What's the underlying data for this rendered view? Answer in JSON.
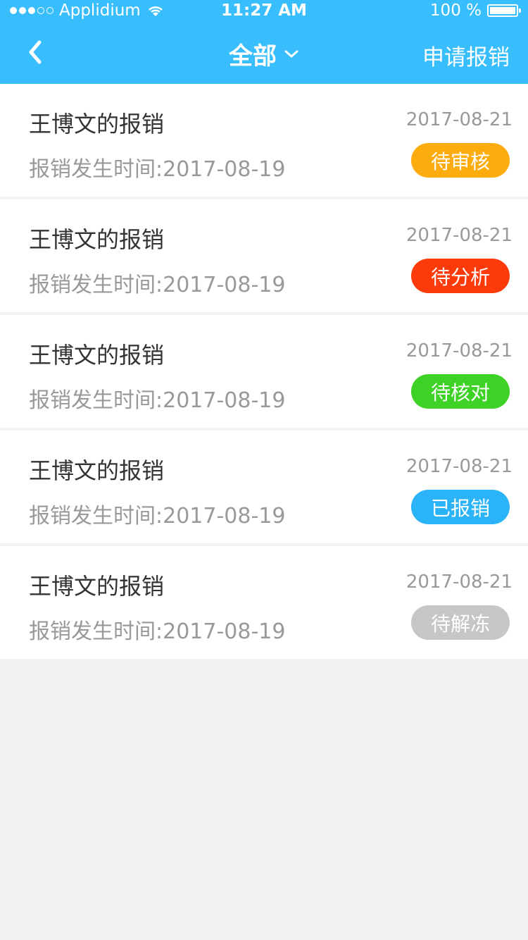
{
  "status_bar": {
    "carrier": "Applidium",
    "time": "11:27 AM",
    "battery_label": "100 %"
  },
  "nav": {
    "title": "全部",
    "apply_label": "申请报销"
  },
  "items": [
    {
      "title": "王博文的报销",
      "date": "2017-08-21",
      "sub_label": "报销发生时间:",
      "sub_date": "2017-08-19",
      "status": "待审核",
      "status_color": "#fdac0e"
    },
    {
      "title": "王博文的报销",
      "date": "2017-08-21",
      "sub_label": "报销发生时间:",
      "sub_date": "2017-08-19",
      "status": "待分析",
      "status_color": "#fd3a0a"
    },
    {
      "title": "王博文的报销",
      "date": "2017-08-21",
      "sub_label": "报销发生时间:",
      "sub_date": "2017-08-19",
      "status": "待核对",
      "status_color": "#3ed126"
    },
    {
      "title": "王博文的报销",
      "date": "2017-08-21",
      "sub_label": "报销发生时间:",
      "sub_date": "2017-08-19",
      "status": "已报销",
      "status_color": "#2ab4f7"
    },
    {
      "title": "王博文的报销",
      "date": "2017-08-21",
      "sub_label": "报销发生时间:",
      "sub_date": "2017-08-19",
      "status": "待解冻",
      "status_color": "#c6c6c6"
    }
  ],
  "colors": {
    "header": "#38bdfd",
    "background": "#f2f2f2"
  }
}
